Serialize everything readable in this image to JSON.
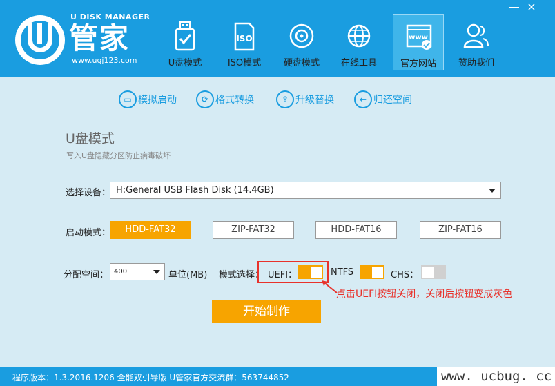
{
  "window": {
    "min_label": "",
    "close_label": "×"
  },
  "logo": {
    "top_text": "U DISK MANAGER",
    "big_text": "管家",
    "url": "www.ugj123.com"
  },
  "nav": [
    {
      "label": "U盘模式",
      "icon": "usb-drive-icon"
    },
    {
      "label": "ISO模式",
      "icon": "iso-disc-icon"
    },
    {
      "label": "硬盘模式",
      "icon": "hard-disk-icon"
    },
    {
      "label": "在线工具",
      "icon": "globe-icon"
    },
    {
      "label": "官方网站",
      "icon": "website-icon",
      "active": true
    },
    {
      "label": "赞助我们",
      "icon": "users-icon"
    }
  ],
  "subtools": [
    {
      "label": "模拟启动",
      "icon": "monitor-icon"
    },
    {
      "label": "格式转换",
      "icon": "refresh-icon"
    },
    {
      "label": "升级替换",
      "icon": "upgrade-icon"
    },
    {
      "label": "归还空间",
      "icon": "back-arrow-icon"
    }
  ],
  "section": {
    "title": "U盘模式",
    "desc": "写入U盘隐藏分区防止病毒破坏"
  },
  "device": {
    "label": "选择设备：",
    "value": "H:General USB Flash Disk (14.4GB)"
  },
  "boot": {
    "label": "启动模式：",
    "modes": [
      "HDD-FAT32",
      "ZIP-FAT32",
      "HDD-FAT16",
      "ZIP-FAT16"
    ],
    "selected": "HDD-FAT32"
  },
  "alloc": {
    "label": "分配空间：",
    "value": "400",
    "unit": "单位(MB)",
    "mode_label": "模式选择：",
    "uefi_label": "UEFI：",
    "uefi_on": true,
    "ntfs_label": "NTFS",
    "ntfs_on": true,
    "chs_label": "CHS：",
    "chs_on": false
  },
  "annotation": "点击UEFI按钮关闭，关闭后按钮变成灰色",
  "start_label": "开始制作",
  "footer": {
    "text": "程序版本：1.3.2016.1206 全能双引导版 U管家官方交流群：563744852"
  },
  "watermark": "www. ucbug. cc",
  "colors": {
    "header": "#1a9de0",
    "accent": "#f7a400",
    "annotation": "#e8322b",
    "background": "#d6ebf4"
  }
}
